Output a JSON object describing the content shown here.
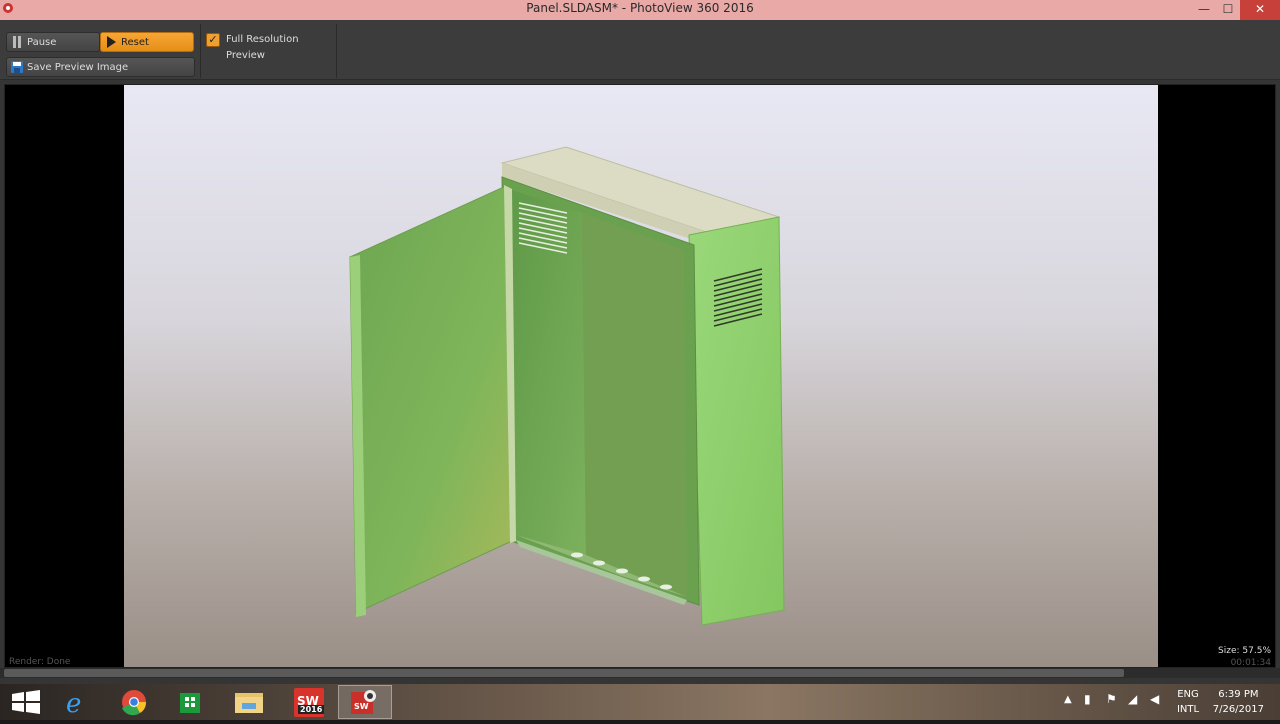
{
  "window": {
    "title": "Panel.SLDASM* - PhotoView 360 2016",
    "minimize_glyph": "—",
    "maximize_glyph": "☐",
    "close_glyph": "✕"
  },
  "toolbar": {
    "pause_label": "Pause",
    "reset_label": "Reset",
    "save_label": "Save Preview Image",
    "full_res_label": "Full Resolution Preview",
    "full_res_checked": true
  },
  "status": {
    "render_state": "Render: Done",
    "size": "Size: 57.5%",
    "elapsed": "00:01:34"
  },
  "taskbar": {
    "apps": [
      "start",
      "internet-explorer",
      "chrome",
      "store",
      "file-explorer",
      "solidworks-2016",
      "photoview-360"
    ],
    "sw_badge": "2016"
  },
  "tray": {
    "language": "ENG",
    "layout": "INTL",
    "time": "6:39 PM",
    "date": "7/26/2017"
  },
  "colors": {
    "accent": "#f0a030",
    "titlebar": "#e9a9a6",
    "cabinet_green": "#8ccc66"
  }
}
